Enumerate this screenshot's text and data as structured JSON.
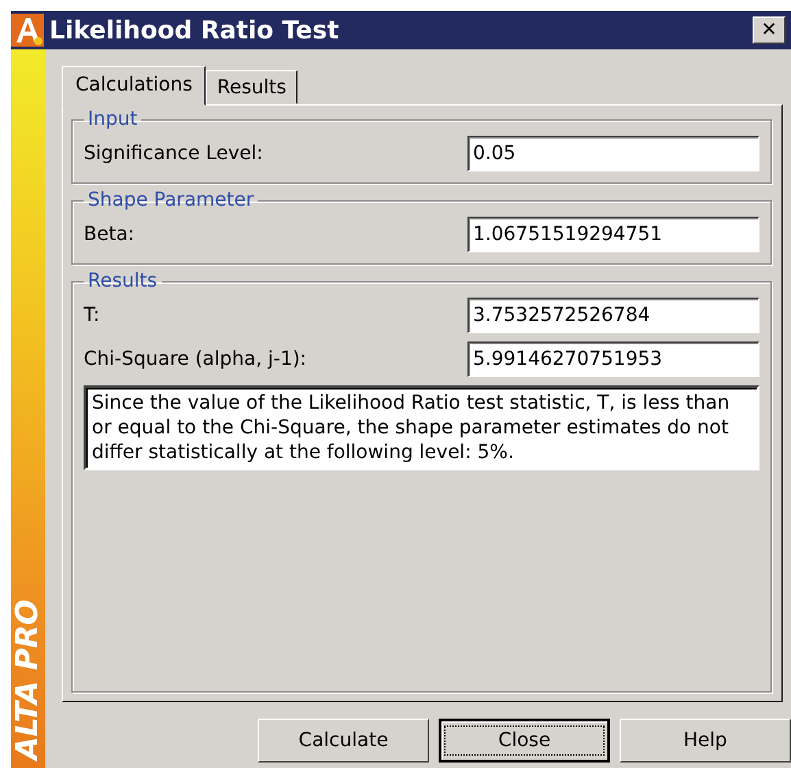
{
  "window": {
    "title": "Likelihood Ratio Test",
    "close_glyph": "✕"
  },
  "brand": "ALTA PRO",
  "tabs": [
    {
      "label": "Calculations",
      "selected": true
    },
    {
      "label": "Results",
      "selected": false
    }
  ],
  "groups": [
    {
      "title": "Input",
      "fields": [
        {
          "label": "Significance Level:",
          "value": "0.05"
        }
      ]
    },
    {
      "title": "Shape Parameter",
      "fields": [
        {
          "label": "Beta:",
          "value": "1.06751519294751"
        }
      ]
    },
    {
      "title": "Results",
      "fields": [
        {
          "label": "T:",
          "value": "3.7532572526784"
        },
        {
          "label": "Chi-Square (alpha, j-1):",
          "value": "5.99146270751953"
        }
      ],
      "message": "Since the value of the Likelihood Ratio test statistic, T, is less than or equal to the Chi-Square, the shape parameter estimates do not differ statistically at the following level: 5%."
    }
  ],
  "buttons": [
    {
      "label": "Calculate",
      "focused": false
    },
    {
      "label": "Close",
      "focused": true
    },
    {
      "label": "Help",
      "focused": false
    }
  ]
}
